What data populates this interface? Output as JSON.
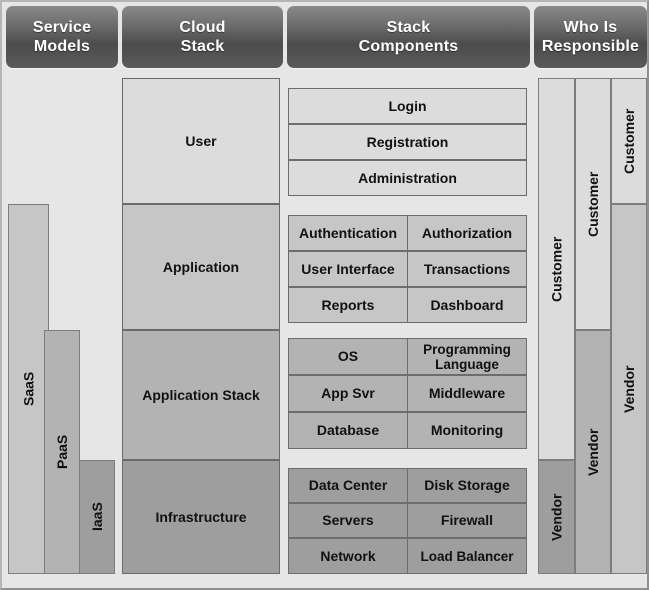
{
  "headers": [
    {
      "line1": "Service",
      "line2": "Models"
    },
    {
      "line1": "Cloud",
      "line2": "Stack"
    },
    {
      "line1": "Stack",
      "line2": "Components"
    },
    {
      "line1": "Who Is",
      "line2": "Responsible"
    }
  ],
  "service_models": [
    {
      "label": "SaaS"
    },
    {
      "label": "PaaS"
    },
    {
      "label": "IaaS"
    }
  ],
  "cloud_stack": [
    {
      "label": "User"
    },
    {
      "label": "Application"
    },
    {
      "label": "Application Stack"
    },
    {
      "label": "Infrastructure"
    }
  ],
  "stack_components": {
    "user": [
      "Login",
      "Registration",
      "Administration"
    ],
    "application": [
      [
        "Authentication",
        "Authorization"
      ],
      [
        "User Interface",
        "Transactions"
      ],
      [
        "Reports",
        "Dashboard"
      ]
    ],
    "application_stack": [
      [
        "OS",
        "Programming Language"
      ],
      [
        "App Svr",
        "Middleware"
      ],
      [
        "Database",
        "Monitoring"
      ]
    ],
    "infrastructure": [
      [
        "Data Center",
        "Disk Storage"
      ],
      [
        "Servers",
        "Firewall"
      ],
      [
        "Network",
        "Load Balancer"
      ]
    ]
  },
  "responsibility": {
    "saas": {
      "top": "Customer",
      "bottom": "Vendor"
    },
    "paas": {
      "top": "Customer",
      "bottom": "Vendor"
    },
    "iaas": {
      "top": "Customer",
      "bottom": "Vendor"
    }
  },
  "colors": {
    "header_dark": "#4c4c4c",
    "shade_lightest": "#dcdcdc",
    "shade_light": "#c6c6c6",
    "shade_mid": "#b3b3b3",
    "shade_dark": "#9e9e9e",
    "frame": "#8f8f8f",
    "page": "#e6e6e6"
  }
}
